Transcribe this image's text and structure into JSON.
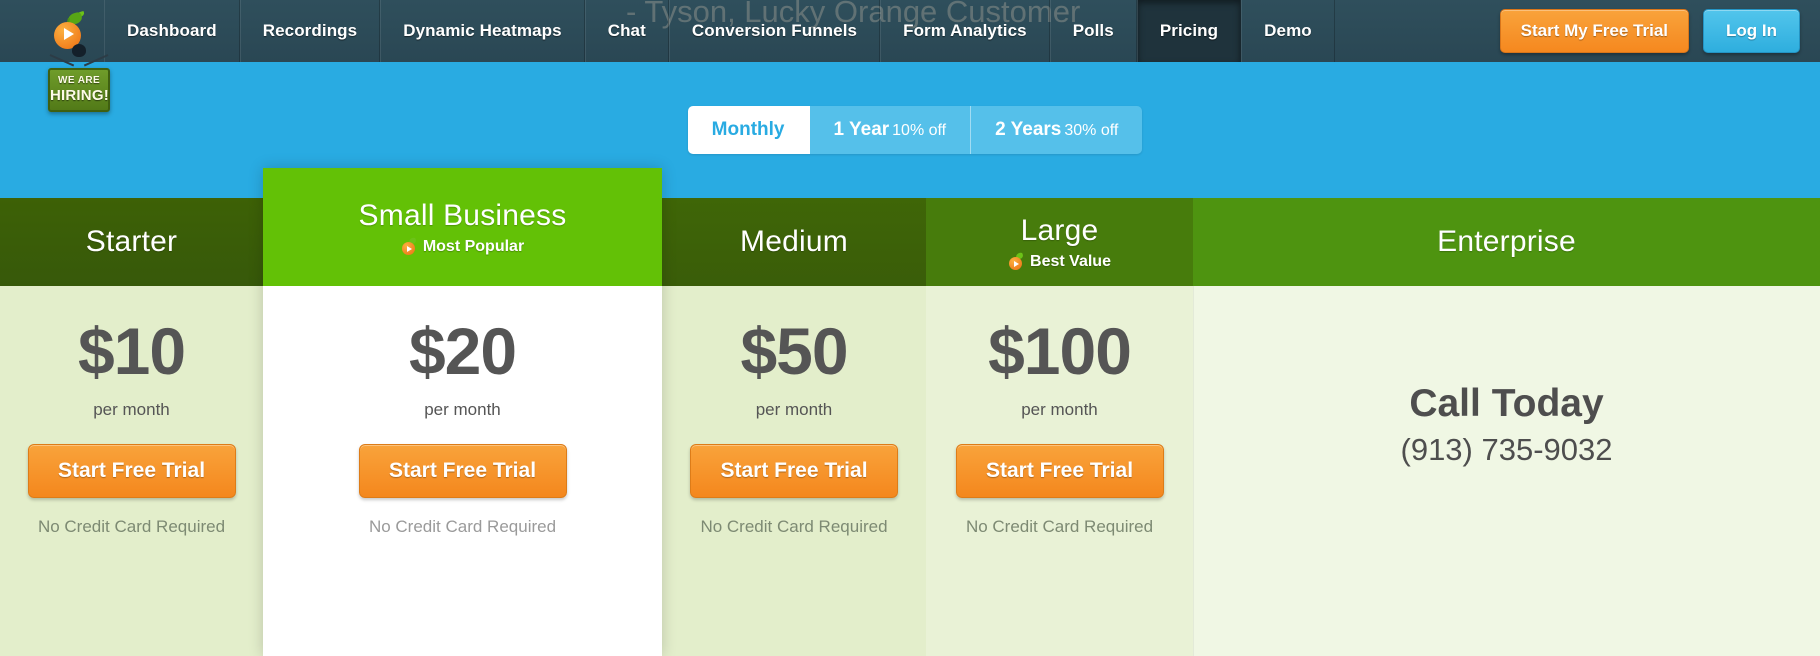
{
  "nav": {
    "logo_icon": "lucky-orange-logo-icon",
    "items": [
      {
        "label": "Dashboard",
        "active": false
      },
      {
        "label": "Recordings",
        "active": false
      },
      {
        "label": "Dynamic Heatmaps",
        "active": false
      },
      {
        "label": "Chat",
        "active": false
      },
      {
        "label": "Conversion Funnels",
        "active": false
      },
      {
        "label": "Form Analytics",
        "active": false
      },
      {
        "label": "Polls",
        "active": false
      },
      {
        "label": "Pricing",
        "active": true
      },
      {
        "label": "Demo",
        "active": false
      }
    ],
    "trial_button": "Start My Free Trial",
    "login_button": "Log In",
    "ghost_quote": "- Tyson, Lucky Orange Customer"
  },
  "hiring_badge": {
    "line1": "WE ARE",
    "line2": "HIRING!"
  },
  "billing": {
    "options": [
      {
        "label": "Monthly",
        "discount": "",
        "active": true
      },
      {
        "label": "1 Year",
        "discount": "10% off",
        "active": false
      },
      {
        "label": "2 Years",
        "discount": "30% off",
        "active": false
      }
    ]
  },
  "plans": [
    {
      "key": "starter",
      "title": "Starter",
      "badge": "",
      "price": "$10",
      "price_note": "per month",
      "cta": "Start Free Trial",
      "no_cc": "No Credit Card Required"
    },
    {
      "key": "small",
      "title": "Small Business",
      "badge": "Most Popular",
      "price": "$20",
      "price_note": "per month",
      "cta": "Start Free Trial",
      "no_cc": "No Credit Card Required"
    },
    {
      "key": "medium",
      "title": "Medium",
      "badge": "",
      "price": "$50",
      "price_note": "per month",
      "cta": "Start Free Trial",
      "no_cc": "No Credit Card Required"
    },
    {
      "key": "large",
      "title": "Large",
      "badge": "Best Value",
      "price": "$100",
      "price_note": "per month",
      "cta": "Start Free Trial",
      "no_cc": "No Credit Card Required"
    },
    {
      "key": "enterprise",
      "title": "Enterprise",
      "badge": "",
      "call_heading": "Call Today",
      "call_phone": "(913) 735-9032"
    }
  ],
  "colors": {
    "nav_bg": "#2f4f5c",
    "nav_active": "#1f333c",
    "hero_blue": "#29abe2",
    "orange": "#f5881f",
    "login_blue": "#2eaede",
    "green_bright": "#63c106",
    "green_dark": "#3d6106",
    "pale_green": "#e3eecb"
  }
}
